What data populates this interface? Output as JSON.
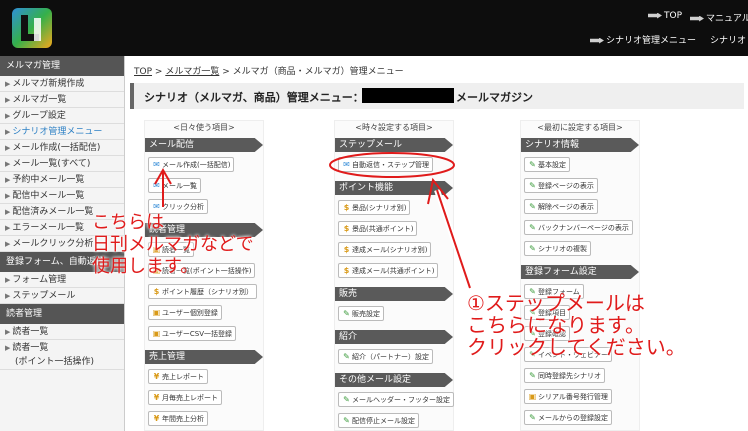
{
  "header": {
    "top_link": "TOP",
    "manual_link": "マニュアル",
    "scenario_menu_link": "シナリオ管理メニュー",
    "scenario_link": "シナリオ"
  },
  "sidebar": {
    "sections": [
      {
        "title": "メルマガ管理",
        "items": [
          {
            "label": "メルマガ新規作成"
          },
          {
            "label": "メルマガ一覧"
          },
          {
            "label": "グループ設定"
          },
          {
            "label": "シナリオ管理メニュー",
            "active": true
          },
          {
            "label": "メール作成(一括配信)"
          },
          {
            "label": "メール一覧(すべて)"
          },
          {
            "label": "予約中メール一覧"
          },
          {
            "label": "配信中メール一覧"
          },
          {
            "label": "配信済みメール一覧"
          },
          {
            "label": "エラーメール一覧"
          },
          {
            "label": "メールクリック分析"
          }
        ]
      },
      {
        "title": "登録フォーム、自動返信",
        "items": [
          {
            "label": "フォーム管理"
          },
          {
            "label": "ステップメール"
          }
        ]
      },
      {
        "title": "読者管理",
        "items": [
          {
            "label": "読者一覧"
          },
          {
            "label": "読者一覧",
            "sub": "(ポイント一括操作)"
          }
        ]
      }
    ]
  },
  "main": {
    "breadcrumb": {
      "top": "TOP",
      "sep": ">",
      "list": "メルマガ一覧",
      "current": "メルマガ（商品・メルマガ）管理メニュー"
    },
    "title_prefix": "シナリオ（メルマガ、商品）管理メニュー：",
    "title_suffix": "メールマガジン",
    "columns": [
      {
        "header": "<日々使う項目>",
        "sections": [
          {
            "title": "メール配信",
            "buttons": [
              {
                "icon": "mail-icon",
                "label": "メール作成(一括配信)"
              },
              {
                "icon": "mail-icon",
                "label": "メール一覧"
              },
              {
                "icon": "mail-icon",
                "label": "クリック分析"
              }
            ]
          },
          {
            "title": "読者管理",
            "buttons": [
              {
                "icon": "user-icon",
                "label": "読者一覧"
              },
              {
                "icon": "user-icon",
                "label": "読者一覧(ポイント一括操作)"
              },
              {
                "icon": "dollar-icon",
                "label": "ポイント履歴（シナリオ別）"
              },
              {
                "icon": "user-icon",
                "label": "ユーザー個別登録"
              },
              {
                "icon": "user-icon",
                "label": "ユーザーCSV一括登録"
              }
            ]
          },
          {
            "title": "売上管理",
            "buttons": [
              {
                "icon": "yen-icon",
                "label": "売上レポート"
              },
              {
                "icon": "yen-icon",
                "label": "月毎売上レポート"
              },
              {
                "icon": "yen-icon",
                "label": "年間売上分析"
              }
            ]
          }
        ]
      },
      {
        "header": "<時々設定する項目>",
        "sections": [
          {
            "title": "ステップメール",
            "buttons": [
              {
                "icon": "mail-icon",
                "label": "自動返信・ステップ管理"
              }
            ]
          },
          {
            "title": "ポイント機能",
            "buttons": [
              {
                "icon": "dollar-icon",
                "label": "景品(シナリオ別)"
              },
              {
                "icon": "dollar-icon",
                "label": "景品(共通ポイント)"
              },
              {
                "icon": "dollar-icon",
                "label": "達成メール(シナリオ別)"
              },
              {
                "icon": "dollar-icon",
                "label": "達成メール(共通ポイント)"
              }
            ]
          },
          {
            "title": "販売",
            "buttons": [
              {
                "icon": "pencil-icon",
                "label": "販売設定"
              }
            ]
          },
          {
            "title": "紹介",
            "buttons": [
              {
                "icon": "pencil-icon",
                "label": "紹介（パートナー）設定"
              }
            ]
          },
          {
            "title": "その他メール設定",
            "buttons": [
              {
                "icon": "pencil-icon",
                "label": "メールヘッダー・フッター設定"
              },
              {
                "icon": "pencil-icon",
                "label": "配信停止メール設定"
              }
            ]
          }
        ]
      },
      {
        "header": "<最初に設定する項目>",
        "sections": [
          {
            "title": "シナリオ情報",
            "buttons": [
              {
                "icon": "pencil-icon",
                "label": "基本設定"
              },
              {
                "icon": "pencil-icon",
                "label": "登録ページの表示"
              },
              {
                "icon": "pencil-icon",
                "label": "解除ページの表示"
              },
              {
                "icon": "pencil-icon",
                "label": "バックナンバーページの表示"
              },
              {
                "icon": "pencil-icon",
                "label": "シナリオの複製"
              }
            ]
          },
          {
            "title": "登録フォーム設定",
            "buttons": [
              {
                "icon": "pencil-icon",
                "label": "登録フォーム"
              },
              {
                "icon": "pencil-icon",
                "label": "登録項目"
              },
              {
                "icon": "pencil-icon",
                "label": "登録確認"
              },
              {
                "icon": "pencil-icon",
                "label": "イベント・ウェビナー"
              },
              {
                "icon": "pencil-icon",
                "label": "同時登録先シナリオ"
              },
              {
                "icon": "user-icon",
                "label": "シリアル番号発行管理"
              },
              {
                "icon": "pencil-icon",
                "label": "メールからの登録設定"
              }
            ]
          }
        ]
      }
    ]
  },
  "annotations": {
    "left_lines": [
      "こちらは",
      "日刊メルマガなどで",
      "使用します。"
    ],
    "right_lines": [
      "①ステップメールは",
      "こちらになります。",
      "クリックしてください。"
    ]
  },
  "colors": {
    "annotation": "#e01b1b",
    "header_bg": "#0d0d0d",
    "section_bg": "#5a5a5a",
    "link_active": "#2b7fc4"
  }
}
